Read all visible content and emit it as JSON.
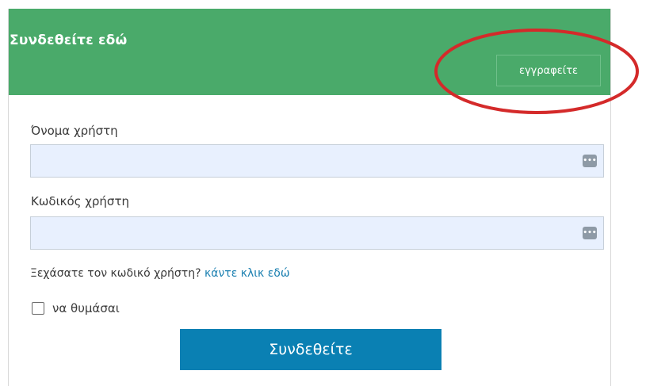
{
  "header": {
    "title": "Συνδεθείτε εδώ",
    "register_label": "εγγραφείτε",
    "accent_color": "#4aaa6a"
  },
  "annotation": {
    "shape": "ellipse",
    "color": "#d42a2a",
    "target": "register-button"
  },
  "form": {
    "username": {
      "label": "Όνομα χρήστη",
      "value": "",
      "icon": "password-manager-icon"
    },
    "password": {
      "label": "Κωδικός χρήστη",
      "value": "",
      "icon": "password-manager-icon"
    },
    "forgot": {
      "text": "Ξεχάσατε τον κωδικό χρήστη?",
      "link_label": "κάντε κλικ εδώ",
      "link_color": "#1a7fb0"
    },
    "remember": {
      "label": "να θυμάσαι",
      "checked": false
    },
    "submit_label": "Συνδεθείτε",
    "submit_color": "#0a80b3"
  }
}
